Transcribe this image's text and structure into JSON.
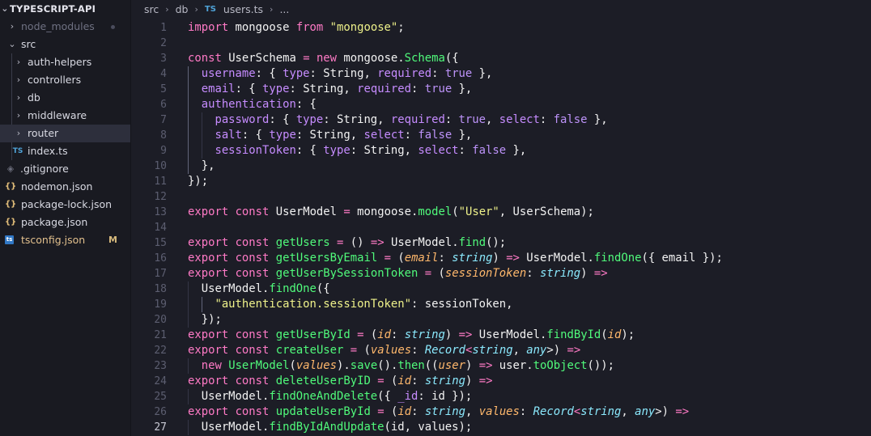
{
  "explorer": {
    "root": "TYPESCRIPT-API",
    "items": [
      {
        "label": "node_modules",
        "kind": "folder",
        "state": "collapsed"
      },
      {
        "label": "src",
        "kind": "folder",
        "state": "expanded"
      },
      {
        "label": "auth-helpers",
        "kind": "folder",
        "state": "collapsed"
      },
      {
        "label": "controllers",
        "kind": "folder",
        "state": "collapsed"
      },
      {
        "label": "db",
        "kind": "folder",
        "state": "collapsed"
      },
      {
        "label": "middleware",
        "kind": "folder",
        "state": "collapsed"
      },
      {
        "label": "router",
        "kind": "folder",
        "state": "collapsed"
      },
      {
        "label": "index.ts",
        "kind": "ts",
        "icon_text": "TS"
      },
      {
        "label": ".gitignore",
        "kind": "gitignore"
      },
      {
        "label": "nodemon.json",
        "kind": "json",
        "icon_text": "{}"
      },
      {
        "label": "package-lock.json",
        "kind": "json",
        "icon_text": "{}"
      },
      {
        "label": "package.json",
        "kind": "json",
        "icon_text": "{}"
      },
      {
        "label": "tsconfig.json",
        "kind": "tsconfig",
        "icon_text": "ts",
        "status": "M"
      }
    ]
  },
  "breadcrumb": {
    "parts": [
      "src",
      "db",
      "users.ts",
      "..."
    ],
    "file_icon": "TS"
  },
  "editor": {
    "language": "typescript",
    "line_numbers": [
      "1",
      "2",
      "3",
      "4",
      "5",
      "6",
      "7",
      "8",
      "9",
      "10",
      "11",
      "12",
      "13",
      "14",
      "15",
      "16",
      "17",
      "18",
      "19",
      "20",
      "21",
      "22",
      "23",
      "24",
      "25",
      "26",
      "27"
    ],
    "lines": [
      "import mongoose from \"mongoose\";",
      "",
      "const UserSchema = new mongoose.Schema({",
      "  username: { type: String, required: true },",
      "  email: { type: String, required: true },",
      "  authentication: {",
      "    password: { type: String, required: true, select: false },",
      "    salt: { type: String, select: false },",
      "    sessionToken: { type: String, select: false },",
      "  },",
      "});",
      "",
      "export const UserModel = mongoose.model(\"User\", UserSchema);",
      "",
      "export const getUsers = () => UserModel.find();",
      "export const getUsersByEmail = (email: string) => UserModel.findOne({ email });",
      "export const getUserBySessionToken = (sessionToken: string) =>",
      "  UserModel.findOne({",
      "    \"authentication.sessionToken\": sessionToken,",
      "  });",
      "export const getUserById = (id: string) => UserModel.findById(id);",
      "export const createUser = (values: Record<string, any>) =>",
      "  new UserModel(values).save().then((user) => user.toObject());",
      "export const deleteUserByID = (id: string) =>",
      "  UserModel.findOneAndDelete({ _id: id });",
      "export const updateUserById = (id: string, values: Record<string, any>) =>",
      "  UserModel.findByIdAndUpdate(id, values);"
    ]
  }
}
